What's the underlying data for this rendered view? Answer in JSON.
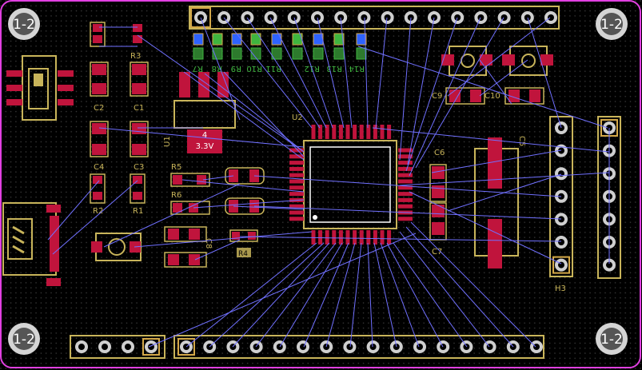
{
  "colors": {
    "background": "#000000",
    "board_outline": "#e040e0",
    "grid_dot": "#3a3a3a",
    "silkscreen": "#c8b45a",
    "pad_fill": "#c0143c",
    "pad_border": "#d4a848",
    "ratsnest": "#7070ff",
    "copper_ring": "#cfcfcf",
    "mounting_hole": "#d0d0d0",
    "led_green": "#3fb53f",
    "led_blue": "#2e63ff"
  },
  "mounting_holes": [
    {
      "label": "1-2"
    },
    {
      "label": "1-2"
    },
    {
      "label": "1-2"
    },
    {
      "label": "1-2"
    }
  ],
  "refdes": {
    "r3": "R3",
    "r7": "R7",
    "r8": "R8",
    "r9": "R9",
    "r10": "R10",
    "r11": "R11",
    "r12": "R12",
    "r13": "R13",
    "r14": "R14",
    "c1": "C1",
    "c2": "C2",
    "c3": "C3",
    "c4": "C4",
    "r1": "R1",
    "r2": "R2",
    "r4": "R4",
    "r5": "R5",
    "r6": "R6",
    "u1": "U1",
    "u2": "U2",
    "c5": "C5",
    "c6": "C6",
    "c7": "C7",
    "c8": "C8",
    "c9": "C9",
    "c10": "C10",
    "h3": "H3",
    "u1_pin_number": "4",
    "u1_net": "3.3V"
  }
}
